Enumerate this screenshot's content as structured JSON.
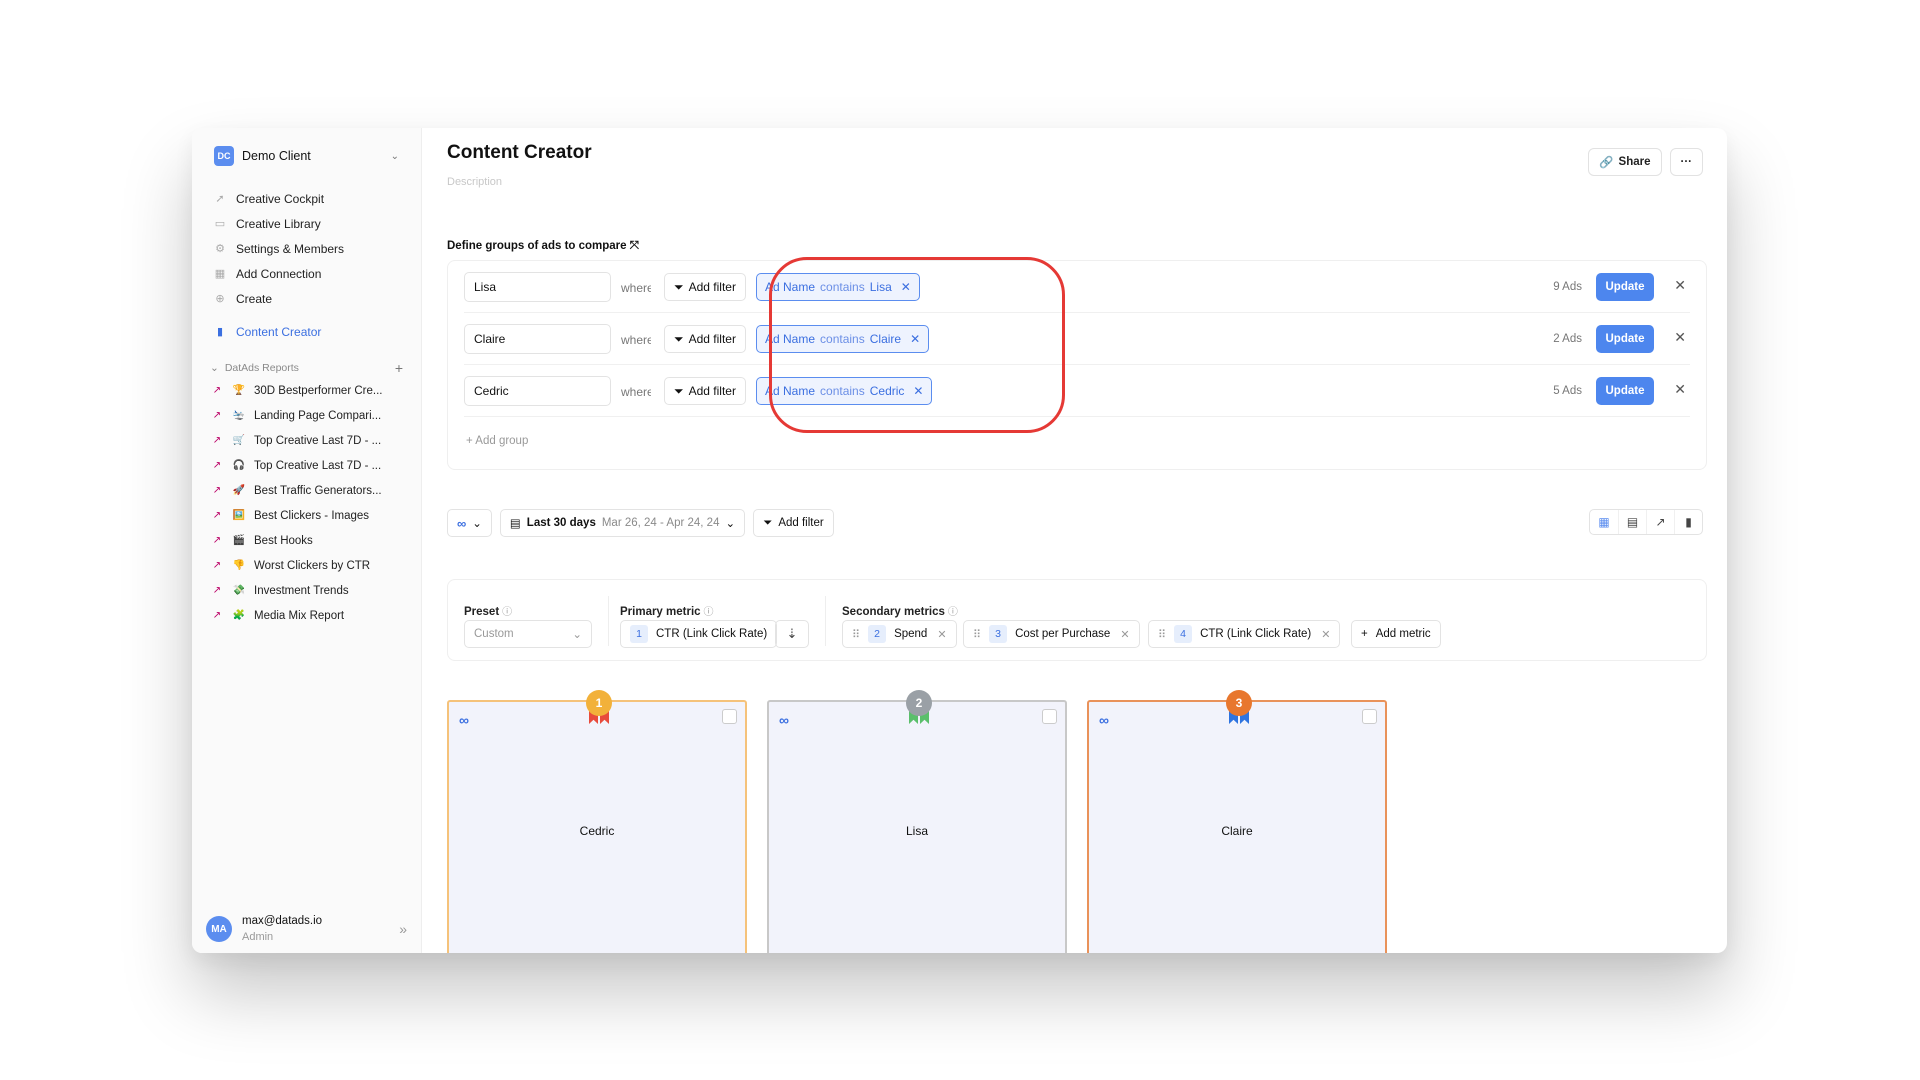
{
  "sidebar": {
    "client": {
      "badge": "DC",
      "name": "Demo Client"
    },
    "nav": [
      {
        "label": "Creative Cockpit",
        "icon": "rocket-icon"
      },
      {
        "label": "Creative Library",
        "icon": "library-icon"
      },
      {
        "label": "Settings & Members",
        "icon": "gear-icon"
      },
      {
        "label": "Add Connection",
        "icon": "grid-icon"
      },
      {
        "label": "Create",
        "icon": "plus-circle-icon"
      }
    ],
    "active_item": {
      "label": "Content Creator",
      "icon": "bar-chart-icon"
    },
    "reports_section": "DatAds Reports",
    "reports": [
      {
        "emoji": "🏆",
        "label": "30D Bestperformer Cre..."
      },
      {
        "emoji": "🛬",
        "label": "Landing Page Compari..."
      },
      {
        "emoji": "🛒",
        "label": "Top Creative Last 7D - ..."
      },
      {
        "emoji": "🎧",
        "label": "Top Creative Last 7D - ..."
      },
      {
        "emoji": "🚀",
        "label": "Best Traffic Generators..."
      },
      {
        "emoji": "🖼️",
        "label": "Best Clickers - Images"
      },
      {
        "emoji": "🎬",
        "label": "Best Hooks"
      },
      {
        "emoji": "👎",
        "label": "Worst Clickers by CTR"
      },
      {
        "emoji": "💸",
        "label": "Investment Trends"
      },
      {
        "emoji": "🧩",
        "label": "Media Mix Report"
      }
    ],
    "user": {
      "initials": "MA",
      "email": "max@datads.io",
      "role": "Admin"
    }
  },
  "header": {
    "title": "Content Creator",
    "description": "Description",
    "share_label": "Share",
    "more_label": "···"
  },
  "groups": {
    "heading": "Define groups of ads to compare",
    "where_label": "where",
    "add_filter_label": "Add filter",
    "update_label": "Update",
    "add_group_label": "Add group",
    "rows": [
      {
        "name": "Lisa",
        "chip_field": "Ad Name",
        "chip_op": "contains",
        "chip_value": "Lisa",
        "ads": "9 Ads"
      },
      {
        "name": "Claire",
        "chip_field": "Ad Name",
        "chip_op": "contains",
        "chip_value": "Claire",
        "ads": "2 Ads"
      },
      {
        "name": "Cedric",
        "chip_field": "Ad Name",
        "chip_op": "contains",
        "chip_value": "Cedric",
        "ads": "5 Ads"
      }
    ]
  },
  "toolbar": {
    "platform_icon": "meta-icon",
    "date_label": "Last 30 days",
    "date_range": "Mar 26, 24 - Apr 24, 24",
    "add_filter_label": "Add filter",
    "views": [
      "grid-icon",
      "table-icon",
      "trend-icon",
      "bar-chart-icon"
    ]
  },
  "metrics": {
    "preset_label": "Preset",
    "preset_value": "Custom",
    "primary_label": "Primary metric",
    "primary": {
      "num": "1",
      "name": "CTR (Link Click Rate)"
    },
    "secondary_label": "Secondary metrics",
    "secondary": [
      {
        "num": "2",
        "name": "Spend"
      },
      {
        "num": "3",
        "name": "Cost per Purchase"
      },
      {
        "num": "4",
        "name": "CTR (Link Click Rate)"
      }
    ],
    "add_metric_label": "Add metric"
  },
  "creatives": [
    {
      "name": "Cedric",
      "rank": "1",
      "medal": "gold"
    },
    {
      "name": "Lisa",
      "rank": "2",
      "medal": "silver"
    },
    {
      "name": "Claire",
      "rank": "3",
      "medal": "bronze"
    }
  ],
  "colors": {
    "accent": "#4d86ee",
    "highlight": "#e53935",
    "gold": "#f2b13a",
    "silver": "#9aa0a6",
    "bronze": "#e8772e"
  }
}
